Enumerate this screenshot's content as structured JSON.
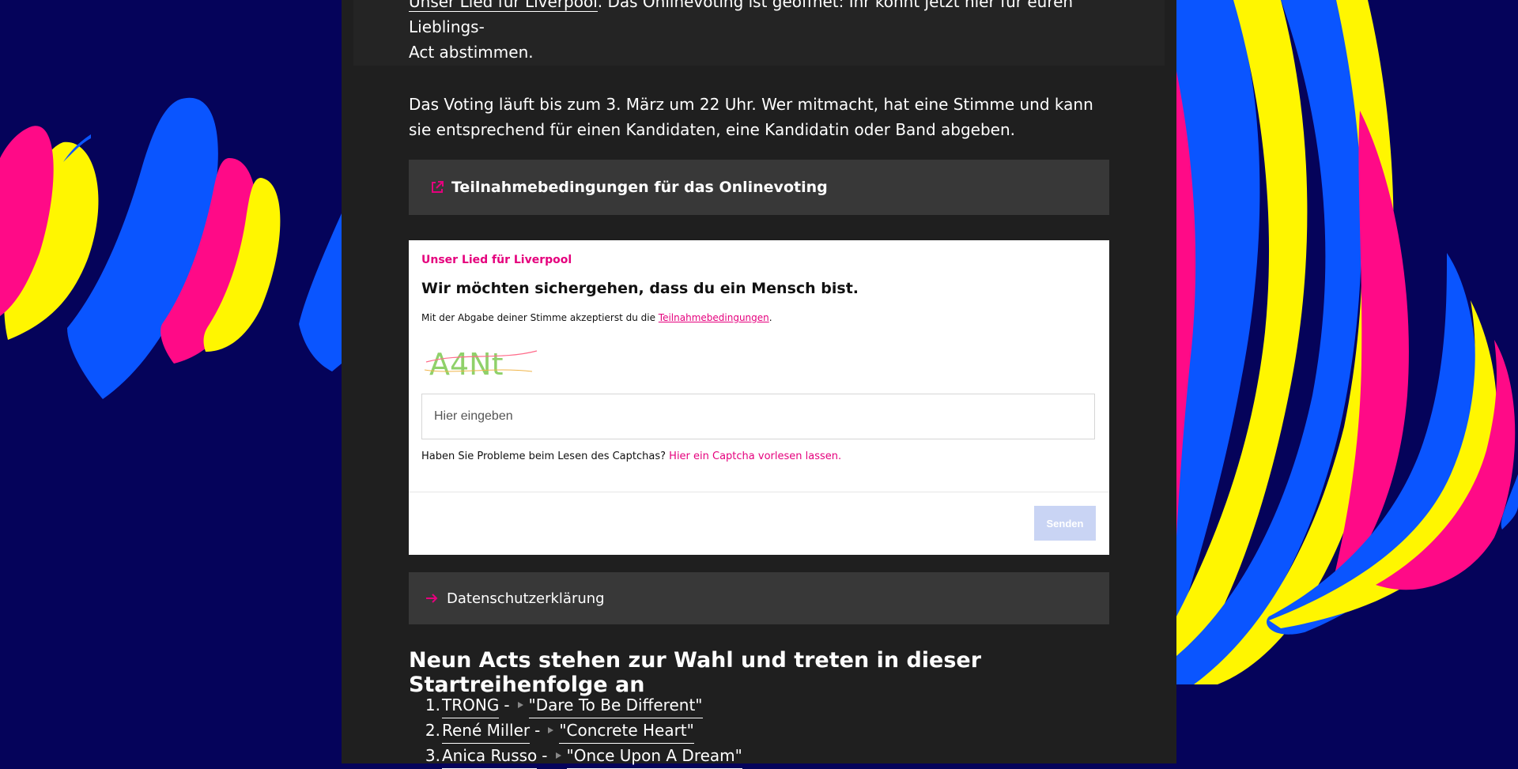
{
  "intro": {
    "link_text": "Unser Lied für Liverpool",
    "text_line1": ". Das Onlinevoting ist geöffnet: Ihr könnt jetzt hier für euren Lieblings-",
    "text_line2": "Act abstimmen."
  },
  "voting_info": "Das Voting läuft bis zum 3. März um 22 Uhr. Wer mitmacht, hat eine Stimme und kann sie ent­sprechend für einen Kandidaten, eine Kandidatin oder Band abgeben.",
  "conditions_link": {
    "label": "Teilnahmebedingungen für das Onlinevoting",
    "icon": "external-link-icon"
  },
  "vote_form": {
    "brand": "Unser Lied für Liverpool",
    "heading": "Wir möchten sichergehen, dass du ein Mensch bist.",
    "terms_prefix": "Mit der Abgabe deiner Stimme akzeptierst du die",
    "terms_link": "Teilnahmebedingungen",
    "terms_suffix": ".",
    "captcha_text": "A4Nt",
    "input_placeholder": "Hier eingeben",
    "input_value": "",
    "help_text": "Haben Sie Probleme beim Lesen des Captchas?",
    "help_link": "Hier ein Captcha vorlesen lassen.",
    "send_label": "Senden"
  },
  "privacy_link": {
    "label": "Datenschutzerklärung",
    "icon": "arrow-right-icon"
  },
  "acts_heading": "Neun Acts stehen zur Wahl und treten in dieser Startreihenfolge an",
  "acts": [
    {
      "num": "1.",
      "name": "TRONG",
      "sep": "-",
      "song": "\"Dare To Be Different\""
    },
    {
      "num": "2.",
      "name": "René Miller",
      "sep": "-",
      "song": "\"Concrete Heart\""
    },
    {
      "num": "3.",
      "name": "Anica Russo",
      "sep": "-",
      "song": "\"Once Upon A Dream\""
    }
  ],
  "colors": {
    "accent": "#e5007d",
    "background": "#05035a",
    "column": "#1f1f1f",
    "panel": "#383838"
  }
}
